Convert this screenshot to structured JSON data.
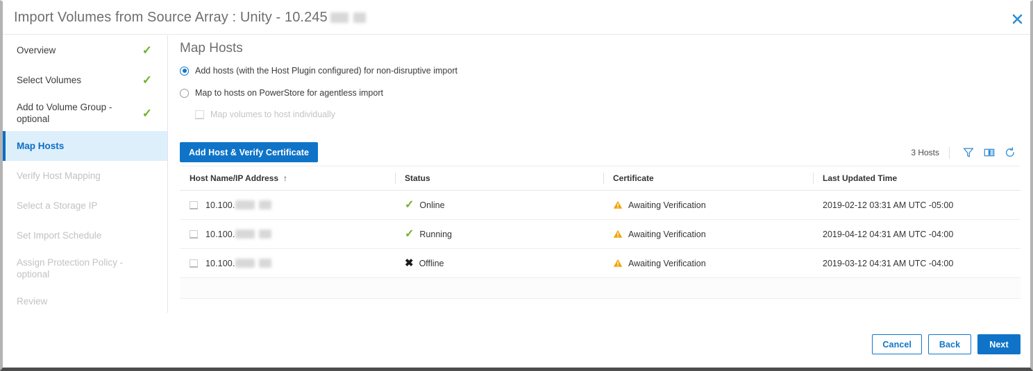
{
  "window": {
    "title_prefix": "Import Volumes from Source Array : Unity - 10.245",
    "close_icon": "close-icon"
  },
  "sidebar": {
    "items": [
      {
        "label": "Overview",
        "state": "complete",
        "check": "✓"
      },
      {
        "label": "Select Volumes",
        "state": "complete",
        "check": "✓"
      },
      {
        "label": "Add to Volume Group - optional",
        "state": "complete",
        "check": "✓"
      },
      {
        "label": "Map Hosts",
        "state": "active",
        "check": ""
      },
      {
        "label": "Verify Host Mapping",
        "state": "disabled",
        "check": ""
      },
      {
        "label": "Select a Storage IP",
        "state": "disabled",
        "check": ""
      },
      {
        "label": "Set Import Schedule",
        "state": "disabled",
        "check": ""
      },
      {
        "label": "Assign Protection Policy - optional",
        "state": "disabled",
        "check": ""
      },
      {
        "label": "Review",
        "state": "disabled",
        "check": ""
      }
    ]
  },
  "main": {
    "page_title": "Map Hosts",
    "options": {
      "radio_1_label": "Add hosts (with the Host Plugin configured) for non-disruptive import",
      "radio_1_selected": true,
      "radio_2_label": "Map to hosts on PowerStore for agentless import",
      "radio_2_selected": false,
      "checkbox_label": "Map volumes to host individually",
      "checkbox_checked": false,
      "checkbox_disabled": true
    },
    "add_host_button": "Add Host & Verify Certificate",
    "toolbar": {
      "count_label": "3 Hosts",
      "filter_icon": "filter-icon",
      "columns_icon": "column-chooser-icon",
      "refresh_icon": "refresh-icon"
    },
    "table": {
      "columns": [
        "Host Name/IP Address",
        "Status",
        "Certificate",
        "Last Updated Time"
      ],
      "sort_column": "Host Name/IP Address",
      "sort_arrow": "↑",
      "rows": [
        {
          "host": "10.100.",
          "status": "Online",
          "status_icon": "check-icon",
          "certificate": "Awaiting Verification",
          "certificate_icon": "warning-icon",
          "last_updated": "2019-02-12 03:31 AM UTC -05:00",
          "selected": false
        },
        {
          "host": "10.100.",
          "status": "Running",
          "status_icon": "check-icon",
          "certificate": "Awaiting Verification",
          "certificate_icon": "warning-icon",
          "last_updated": "2019-04-12 04:31 AM UTC -04:00",
          "selected": false
        },
        {
          "host": "10.100.",
          "status": "Offline",
          "status_icon": "cross-icon",
          "certificate": "Awaiting Verification",
          "certificate_icon": "warning-icon",
          "last_updated": "2019-03-12 04:31 AM UTC -04:00",
          "selected": false
        }
      ]
    }
  },
  "footer": {
    "cancel_label": "Cancel",
    "back_label": "Back",
    "next_label": "Next"
  },
  "colors": {
    "accent_blue": "#0f74c8",
    "link_blue": "#1076c8",
    "active_bg": "#deeffc",
    "success_green": "#6fb129",
    "warning_orange": "#f0a400",
    "title_grey": "#6e6e6e",
    "disabled_grey": "#c2c2c2"
  }
}
